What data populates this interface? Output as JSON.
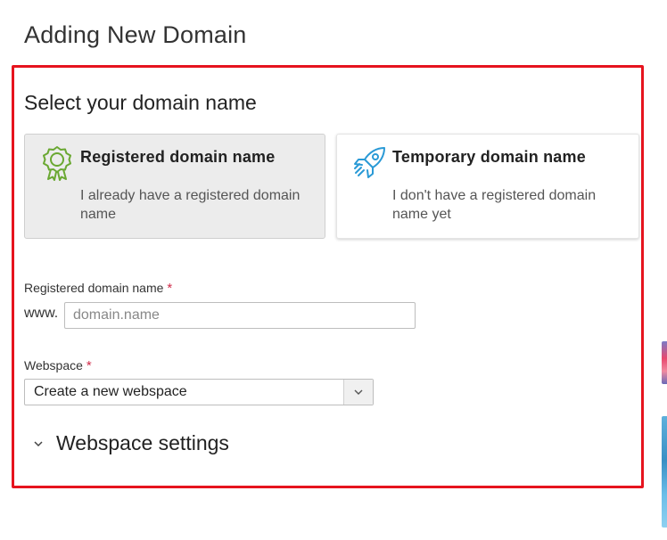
{
  "page": {
    "title": "Adding New Domain"
  },
  "section": {
    "title": "Select your domain name"
  },
  "options": [
    {
      "title": "Registered domain name",
      "description": "I already have a registered domain name",
      "icon": "award-ribbon-icon",
      "selected": true,
      "icon_color": "#6aa832"
    },
    {
      "title": "Temporary domain name",
      "description": "I don't have a registered domain name yet",
      "icon": "rocket-icon",
      "selected": false,
      "icon_color": "#2a9ad6"
    }
  ],
  "form": {
    "domain": {
      "label": "Registered domain name",
      "required_mark": "*",
      "prefix": "www.",
      "placeholder": "domain.name",
      "value": ""
    },
    "webspace": {
      "label": "Webspace",
      "required_mark": "*",
      "selected": "Create a new webspace"
    },
    "settings": {
      "label": "Webspace settings",
      "expanded": false
    }
  },
  "colors": {
    "highlight_border": "#e6141e",
    "required": "#d02c4a"
  }
}
